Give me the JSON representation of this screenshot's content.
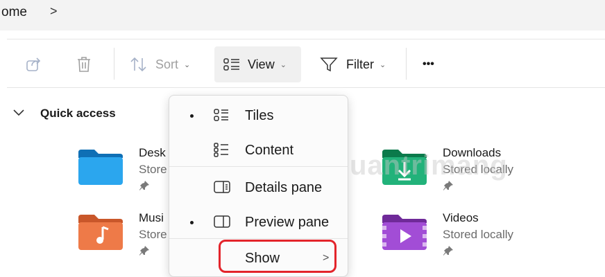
{
  "address": {
    "text": "ome",
    "chevron": ">"
  },
  "toolbar": {
    "share_icon": "share-icon",
    "delete_icon": "trash-icon",
    "sort_label": "Sort",
    "view_label": "View",
    "filter_label": "Filter",
    "more_label": "•••"
  },
  "quick_access": {
    "label": "Quick access"
  },
  "tiles": [
    {
      "name": "Desk",
      "sub": "Store",
      "color": "#1e9ee6",
      "icon": "desktop-folder-icon"
    },
    {
      "name": "Downloads",
      "sub": "Stored locally",
      "color": "#1aa86b",
      "icon": "downloads-folder-icon"
    },
    {
      "name": "Musi",
      "sub": "Store",
      "color": "#f0743e",
      "icon": "music-folder-icon"
    },
    {
      "name": "Videos",
      "sub": "Stored locally",
      "color": "#9b3fc8",
      "icon": "videos-folder-icon"
    }
  ],
  "view_menu": {
    "items": [
      {
        "label": "Tiles",
        "selected": true,
        "icon": "tiles-icon"
      },
      {
        "label": "Content",
        "selected": false,
        "icon": "content-icon"
      },
      {
        "label": "Details pane",
        "selected": false,
        "icon": "details-pane-icon"
      },
      {
        "label": "Preview pane",
        "selected": true,
        "icon": "preview-pane-icon"
      },
      {
        "label": "Show",
        "selected": false,
        "icon": ""
      }
    ],
    "show_chevron": ">"
  },
  "watermark": {
    "text": "uantrimang"
  },
  "colors": {
    "highlight_border": "#e3242b",
    "accent": "#1e9ee6"
  }
}
